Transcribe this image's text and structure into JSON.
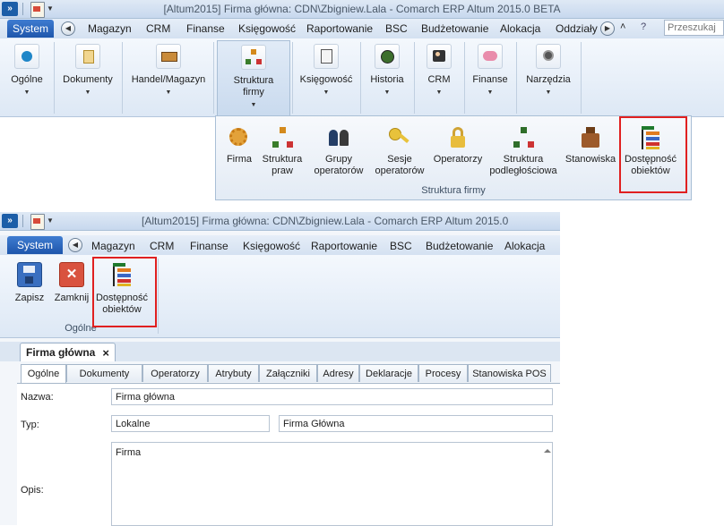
{
  "top_window": {
    "title": "[Altum2015] Firma główna: CDN\\Zbigniew.Lala - Comarch ERP Altum 2015.0 BETA",
    "menu": {
      "system_label": "System",
      "items": [
        "Magazyn",
        "CRM",
        "Finanse",
        "Księgowość",
        "Raportowanie",
        "BSC",
        "Budżetowanie",
        "Alokacja",
        "Oddziały"
      ],
      "search_placeholder": "Przeszukaj"
    },
    "ribbon": [
      {
        "label": "Ogólne"
      },
      {
        "label": "Dokumenty"
      },
      {
        "label": "Handel/Magazyn"
      },
      {
        "label": "Struktura firmy"
      },
      {
        "label": "Księgowość"
      },
      {
        "label": "Historia"
      },
      {
        "label": "CRM"
      },
      {
        "label": "Finanse"
      },
      {
        "label": "Narzędzia"
      }
    ],
    "dropdown": {
      "group_label": "Struktura firmy",
      "buttons": [
        {
          "label": "Firma",
          "icon": "gear-icon"
        },
        {
          "label": "Struktura praw",
          "icon": "org-structure-icon"
        },
        {
          "label": "Grupy operatorów",
          "icon": "users-group-icon"
        },
        {
          "label": "Sesje operatorów",
          "icon": "key-icon"
        },
        {
          "label": "Operatorzy",
          "icon": "lock-icon"
        },
        {
          "label": "Struktura podległościowa",
          "icon": "hierarchy-icon"
        },
        {
          "label": "Stanowiska",
          "icon": "cash-register-icon"
        },
        {
          "label": "Dostępność obiektów",
          "icon": "object-availability-icon"
        }
      ]
    }
  },
  "bottom_window": {
    "title": "[Altum2015] Firma główna: CDN\\Zbigniew.Lala - Comarch ERP Altum 2015.0",
    "menu": {
      "system_label": "System",
      "items": [
        "Magazyn",
        "CRM",
        "Finanse",
        "Księgowość",
        "Raportowanie",
        "BSC",
        "Budżetowanie",
        "Alokacja"
      ]
    },
    "ribbon": {
      "buttons": [
        {
          "label": "Zapisz",
          "icon": "save-icon"
        },
        {
          "label": "Zamknij",
          "icon": "close-icon"
        },
        {
          "label": "Dostępność obiektów",
          "icon": "object-availability-icon"
        }
      ],
      "group_label": "Ogólne"
    },
    "document_tab": {
      "label": "Firma główna",
      "close_symbol": "×"
    },
    "subtabs": [
      "Ogólne",
      "Dokumenty",
      "Operatorzy",
      "Atrybuty",
      "Załączniki",
      "Adresy",
      "Deklaracje",
      "Procesy",
      "Stanowiska POS"
    ],
    "form": {
      "nazwa_label": "Nazwa:",
      "nazwa_value": "Firma główna",
      "typ_label": "Typ:",
      "typ_value_1": "Lokalne",
      "typ_value_2": "Firma Główna",
      "opis_label": "Opis:",
      "opis_value": "Firma"
    }
  },
  "colors": {
    "highlight_box": "#e02020",
    "system_button": "#2a64b8"
  }
}
